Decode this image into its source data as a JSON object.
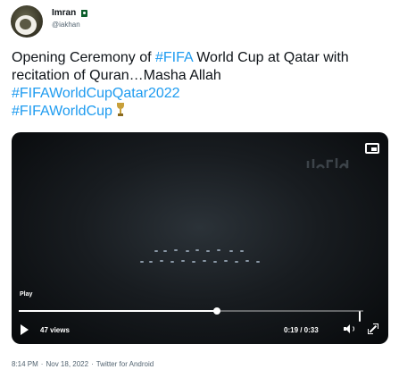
{
  "author": {
    "display_name": "Imran",
    "handle": "@iakhan",
    "flag_icon": "pakistan-flag-icon"
  },
  "tweet": {
    "text_before": "Opening Ceremony of ",
    "hashtag_fifa": "#FIFA",
    "text_after": " World Cup at Qatar with recitation of Quran…Masha Allah",
    "hashtag_qatar": "#FIFAWorldCupQatar2022",
    "hashtag_worldcup": "#FIFAWorldCup",
    "emoji_icon": "trophy-icon"
  },
  "video": {
    "play_label": "Play",
    "views": "47 views",
    "time": "0:19 / 0:33",
    "progress": 0.576,
    "icons": [
      "pip-icon",
      "play-icon",
      "volume-icon",
      "expand-icon"
    ]
  },
  "meta": {
    "time": "8:14 PM",
    "separator": "·",
    "date": "Nov 18, 2022",
    "separator2": "·",
    "source": "Twitter for Android"
  },
  "colors": {
    "link": "#1d9bf0",
    "text": "#0f1419",
    "secondary": "#536471"
  }
}
